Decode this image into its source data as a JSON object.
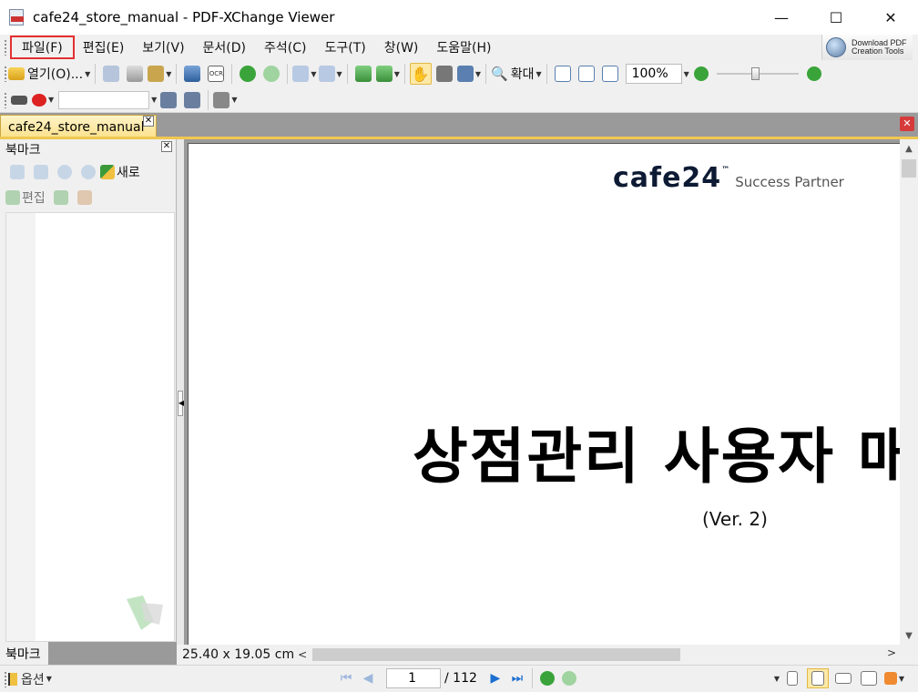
{
  "window": {
    "title": "cafe24_store_manual - PDF-XChange Viewer",
    "minimize": "—",
    "maximize": "☐",
    "close": "✕"
  },
  "menu": {
    "items": [
      "파일(F)",
      "편집(E)",
      "보기(V)",
      "문서(D)",
      "주석(C)",
      "도구(T)",
      "창(W)",
      "도움말(H)"
    ],
    "download_line1": "Download PDF",
    "download_line2": "Creation Tools"
  },
  "toolbar": {
    "open_label": "열기(O)...",
    "zoom_in_label": "확대",
    "zoom_value": "100%",
    "search_placeholder": ""
  },
  "tab": {
    "document_name": "cafe24_store_manual"
  },
  "bookmarks": {
    "title": "북마크",
    "new_label": "새로",
    "edit_label": "편집",
    "footer_tab": "북마크"
  },
  "document": {
    "logo_main": "cafe24",
    "logo_tm": "™",
    "logo_sub": "Success Partner",
    "title": "상점관리 사용자 매뉴얼",
    "version": "(Ver. 2)",
    "page_size": "25.40 x 19.05 cm"
  },
  "status": {
    "options_label": "옵션",
    "current_page": "1",
    "total_pages": "/ 112"
  },
  "colors": {
    "highlight_box": "#e53030",
    "tab_active": "#fbe08a",
    "nav_blue": "#1c6fd1",
    "nav_green": "#3aa43a"
  }
}
